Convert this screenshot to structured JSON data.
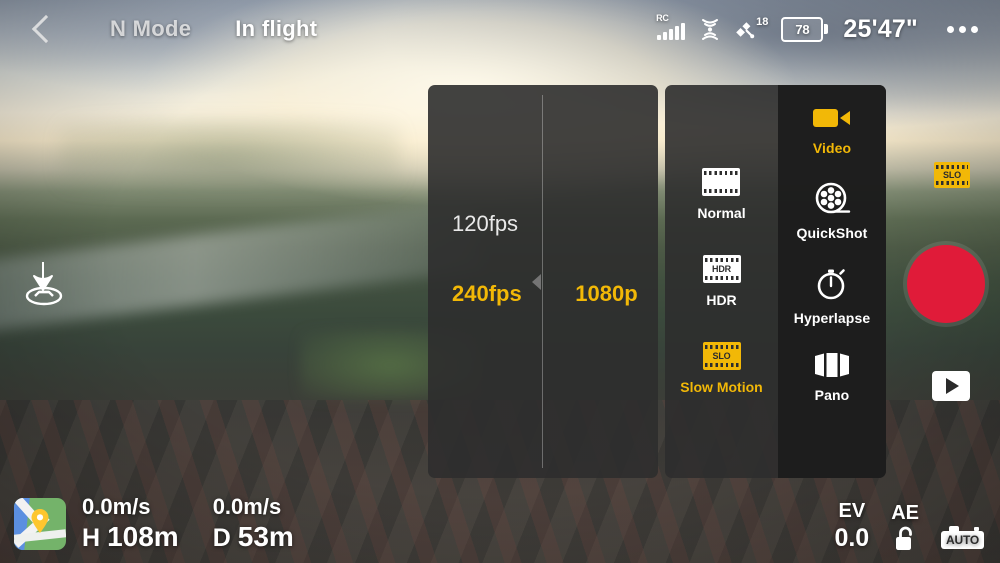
{
  "topbar": {
    "back_icon": "chevron-left-icon",
    "flight_mode": "N Mode",
    "flight_status": "In flight",
    "rc_label": "RC",
    "rc_icon": "rc-signal-icon",
    "video_link_icon": "video-transmission-icon",
    "gps_icon": "satellite-icon",
    "gps_count": "18",
    "battery_icon": "battery-icon",
    "battery_percent": "78",
    "flight_timer": "25'47\"",
    "more_icon": "more-options-icon"
  },
  "overlay": {
    "gimbal_icon": "aircraft-attitude-down-icon"
  },
  "settings_panel": {
    "fps_column": {
      "options": [
        {
          "label": "120fps",
          "selected": false
        },
        {
          "label": "240fps",
          "selected": true
        }
      ]
    },
    "resolution_column": {
      "options": [
        {
          "label": "1080p",
          "selected": true
        }
      ]
    },
    "submodes": [
      {
        "label": "Normal",
        "icon": "film-strip-icon",
        "glyph": "",
        "selected": false
      },
      {
        "label": "HDR",
        "icon": "film-strip-hdr-icon",
        "glyph": "HDR",
        "selected": false
      },
      {
        "label": "Slow Motion",
        "icon": "film-strip-slo-icon",
        "glyph": "SLO",
        "selected": true
      }
    ],
    "modes": [
      {
        "label": "Video",
        "icon": "video-camera-icon",
        "selected": true
      },
      {
        "label": "QuickShot",
        "icon": "film-reel-icon",
        "selected": false
      },
      {
        "label": "Hyperlapse",
        "icon": "stopwatch-icon",
        "selected": false
      },
      {
        "label": "Pano",
        "icon": "panorama-icon",
        "selected": false
      }
    ]
  },
  "right_controls": {
    "slo_badge": "SLO",
    "slo_badge_icon": "film-strip-slo-badge-icon",
    "record_button_icon": "record-button",
    "record_color": "#e01b39",
    "playback_icon": "playback-play-icon"
  },
  "bottom_bar": {
    "map_icon": "map-thumbnail",
    "map_pin_icon": "location-pin-icon",
    "vertical_speed": "0.0m/s",
    "horizontal_speed": "0.0m/s",
    "height_key": "H",
    "height_value": "108m",
    "distance_key": "D",
    "distance_value": "53m",
    "ev_label": "EV",
    "ev_value": "0.0",
    "ae_label": "AE",
    "ae_lock_icon": "padlock-unlocked-icon",
    "auto_label": "AUTO",
    "auto_icon": "camera-auto-icon"
  },
  "colors": {
    "accent_yellow": "#f2b807",
    "record_red": "#e01b39",
    "panel_bg": "#2d2d2d",
    "text_white": "#ffffff"
  }
}
